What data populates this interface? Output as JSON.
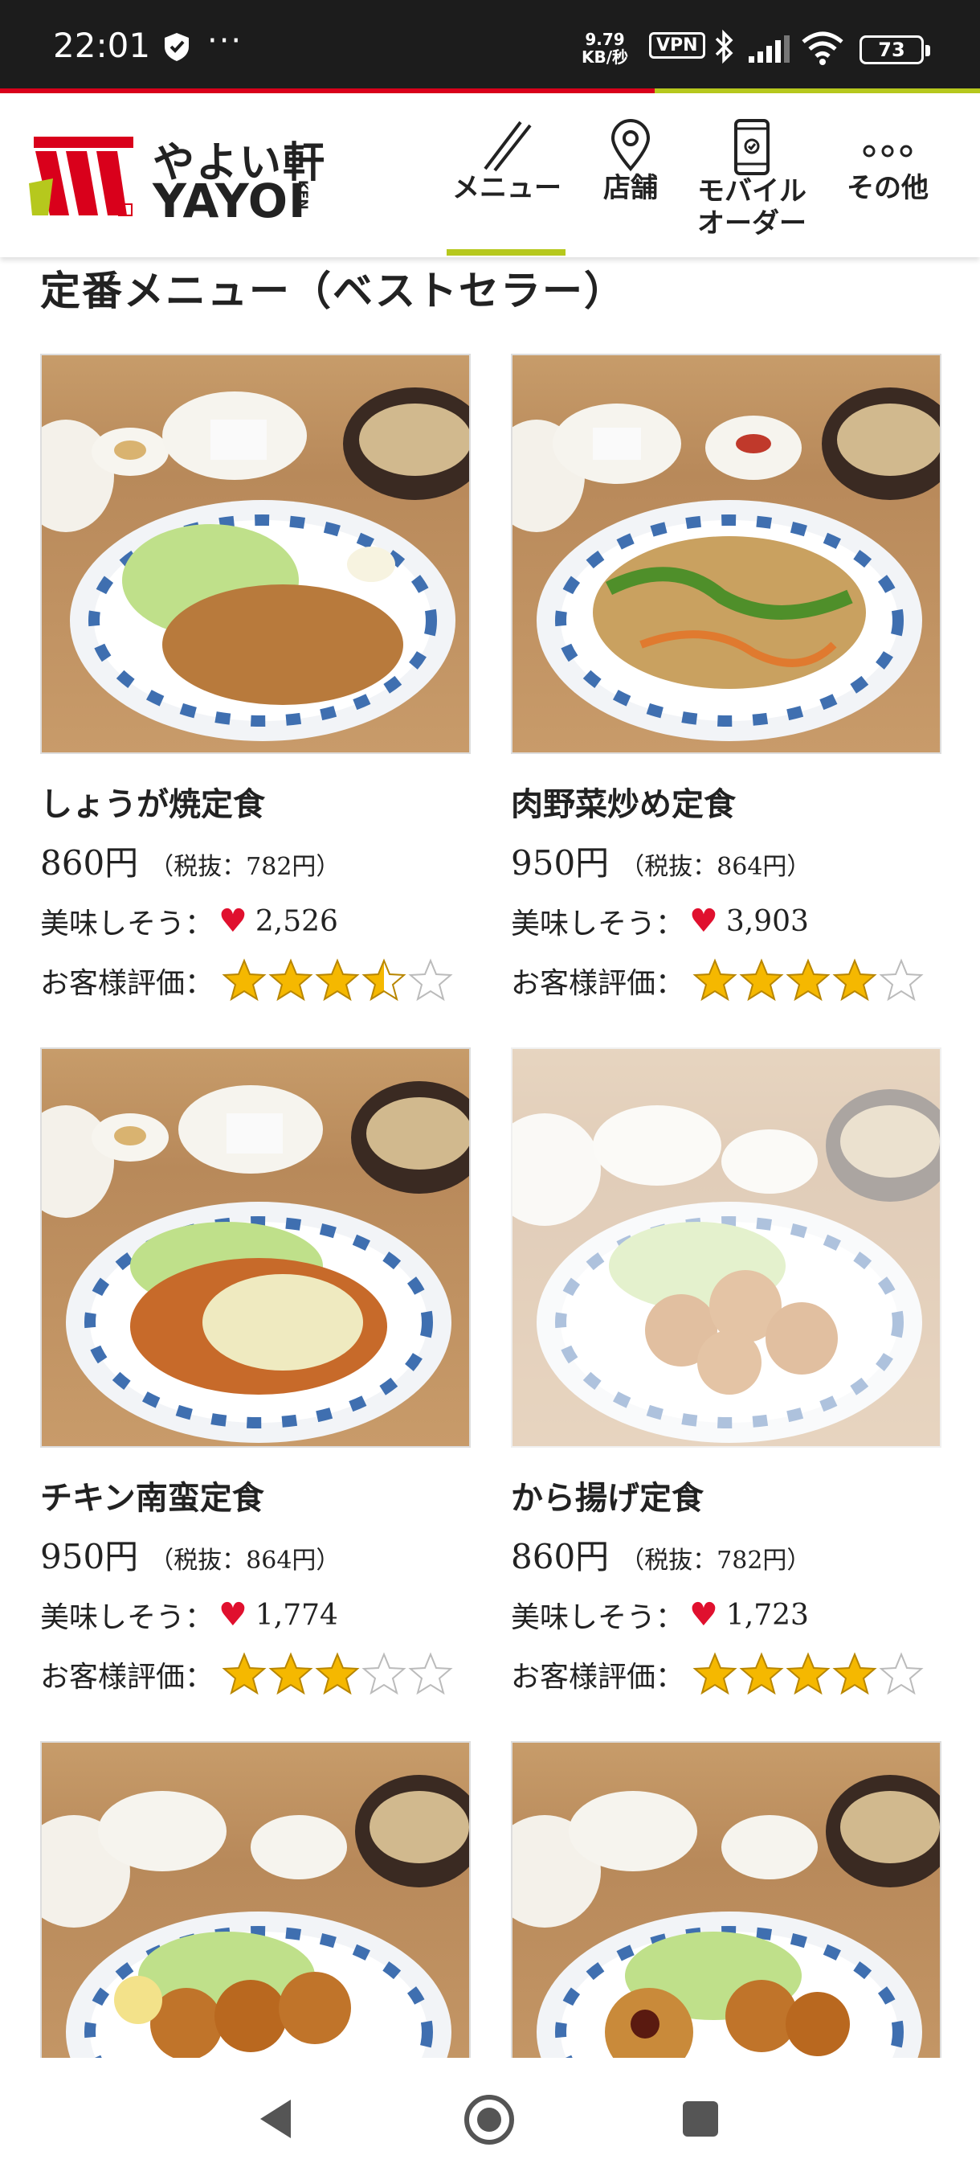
{
  "status_bar": {
    "time": "22:01",
    "dots": "···",
    "speed_top": "9.79",
    "speed_bottom": "KB/秒",
    "vpn": "VPN",
    "battery": "73"
  },
  "header": {
    "logo_jp": "やよい軒",
    "logo_en": "YAYOI",
    "logo_ken": "KEN",
    "nav": {
      "menu": "メニュー",
      "store": "店舗",
      "mobile_line1": "モバイル",
      "mobile_line2": "オーダー",
      "other": "その他"
    }
  },
  "section_title": "定番メニュー（ベストセラー）",
  "labels": {
    "tasty": "美味しそう：",
    "rating": "お客様評価："
  },
  "items": [
    {
      "name": "しょうが焼定食",
      "price": "860円",
      "tax": "（税抜：782円）",
      "likes": "2,526",
      "rating": 3.5,
      "faded": false
    },
    {
      "name": "肉野菜炒め定食",
      "price": "950円",
      "tax": "（税抜：864円）",
      "likes": "3,903",
      "rating": 4,
      "faded": false
    },
    {
      "name": "チキン南蛮定食",
      "price": "950円",
      "tax": "（税抜：864円）",
      "likes": "1,774",
      "rating": 3,
      "faded": false
    },
    {
      "name": "から揚げ定食",
      "price": "860円",
      "tax": "（税抜：782円）",
      "likes": "1,723",
      "rating": 4,
      "faded": true
    }
  ],
  "colors": {
    "brand_red": "#d9001b",
    "brand_green": "#b6c81d",
    "heart": "#e0102e",
    "star": "#f5b800"
  }
}
